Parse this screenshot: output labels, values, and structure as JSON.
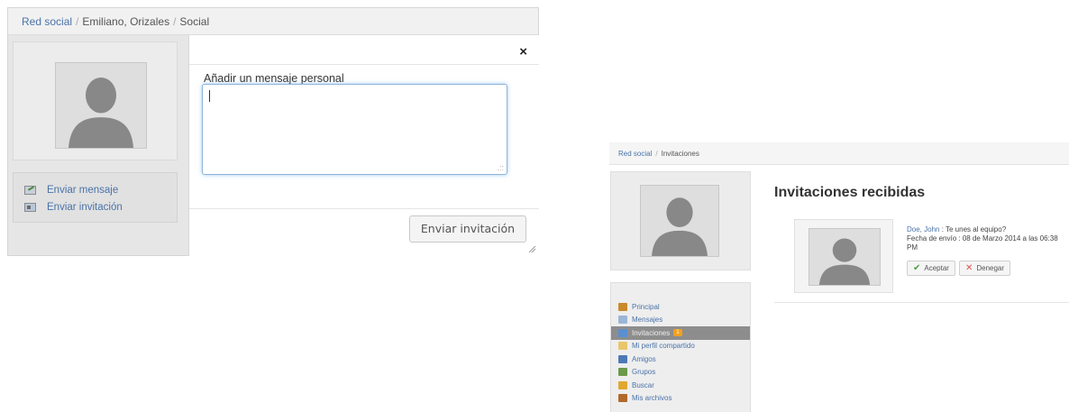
{
  "left": {
    "breadcrumb": {
      "root": "Red social",
      "user": "Emiliano, Orizales",
      "section": "Social"
    },
    "actions": [
      {
        "label": "Enviar mensaje",
        "icon": "message-icon"
      },
      {
        "label": "Enviar invitación",
        "icon": "invitation-card-icon"
      }
    ],
    "modal": {
      "close": "×",
      "label": "Añadir un mensaje personal",
      "textarea_value": "",
      "send_button": "Enviar invitación"
    }
  },
  "right": {
    "breadcrumb": {
      "root": "Red social",
      "section": "Invitaciones"
    },
    "nav": [
      {
        "label": "Principal",
        "icon": "home-icon",
        "color": "#c98a2b"
      },
      {
        "label": "Mensajes",
        "icon": "envelope-icon",
        "color": "#9bb6d6"
      },
      {
        "label": "Invitaciones",
        "icon": "invitations-icon",
        "color": "#5a8fd0",
        "active": true,
        "badge": "1"
      },
      {
        "label": "Mi perfil compartido",
        "icon": "folder-icon",
        "color": "#e8c66a"
      },
      {
        "label": "Amigos",
        "icon": "user-icon",
        "color": "#4d79b5"
      },
      {
        "label": "Grupos",
        "icon": "group-icon",
        "color": "#6a9a4a"
      },
      {
        "label": "Buscar",
        "icon": "search-icon",
        "color": "#e0a830"
      },
      {
        "label": "Mis archivos",
        "icon": "briefcase-icon",
        "color": "#b06a2a"
      }
    ],
    "title": "Invitaciones recibidas",
    "invitation": {
      "sender": "Doe, John",
      "message": " : Te unes al equipo?",
      "date_line": "Fecha de envío : 08 de Marzo 2014 a las 06:38 PM",
      "accept_label": "Aceptar",
      "deny_label": "Denegar"
    }
  },
  "colors": {
    "link": "#4a73a8",
    "focus_border": "#8fb3d9",
    "accept": "#47a447",
    "deny": "#d9534f",
    "badge": "#f0a020"
  }
}
